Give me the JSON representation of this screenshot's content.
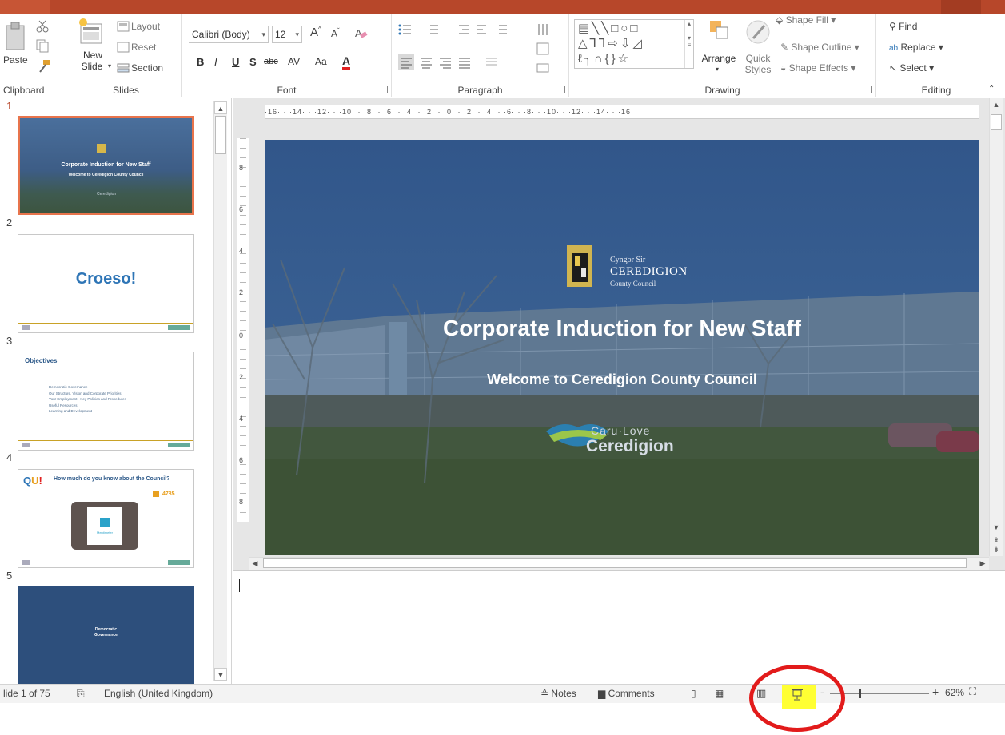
{
  "ribbon": {
    "clipboard": {
      "paste_label": "Paste",
      "group_label": "Clipboard"
    },
    "slides": {
      "new_slide_label": "New",
      "new_slide_label2": "Slide",
      "layout_label": "Layout",
      "reset_label": "Reset",
      "section_label": "Section",
      "group_label": "Slides"
    },
    "font": {
      "font_name": "Calibri (Body)",
      "font_size": "12",
      "group_label": "Font",
      "bold": "B",
      "italic": "I",
      "underline": "U",
      "shadow": "S",
      "strike": "abc",
      "spacing": "AV",
      "case": "Aa",
      "color": "A"
    },
    "paragraph": {
      "group_label": "Paragraph"
    },
    "drawing": {
      "arrange_label": "Arrange",
      "quick_styles_label": "Quick",
      "quick_styles_label2": "Styles",
      "shape_fill": "Shape Fill",
      "shape_outline": "Shape Outline",
      "shape_effects": "Shape Effects",
      "group_label": "Drawing"
    },
    "editing": {
      "find": "Find",
      "replace": "Replace",
      "select": "Select",
      "group_label": "Editing"
    }
  },
  "ruler": {
    "text": "·16· · ·14· · ·12· · ·10· · ·8· · ·6· · ·4· · ·2· · ·0· · ·2· · ·4· · ·6· · ·8· · ·10· · ·12· · ·14· · ·16·",
    "vnums": [
      "8",
      "6",
      "4",
      "2",
      "0",
      "2",
      "4",
      "6",
      "8"
    ]
  },
  "thumbnails": [
    {
      "num": "1",
      "title": "Corporate Induction for New Staff",
      "subtitle": "Welcome to Ceredigion County Council",
      "footer": "Ceredigion"
    },
    {
      "num": "2",
      "title": "Croeso!"
    },
    {
      "num": "3",
      "title": "Objectives",
      "bullets": [
        "Democratic Governance",
        "Our Structure, Vision and Corporate Priorities",
        "Your Employment - Key Policies and Procedures",
        "Useful Resources",
        "Learning and Development"
      ]
    },
    {
      "num": "4",
      "title": "How much do you know about the Council?",
      "code": "4785",
      "app": "Mentimeter"
    },
    {
      "num": "5",
      "title": "Democratic",
      "title2": "Governance"
    }
  ],
  "slide": {
    "logo_line1": "Cyngor Sir",
    "logo_line2": "CEREDIGION",
    "logo_line3": "County Council",
    "title": "Corporate Induction for New Staff",
    "subtitle": "Welcome to Ceredigion County Council",
    "brand_line1": "Caru·Love",
    "brand_line2": "Ceredigion"
  },
  "status": {
    "slide_info": "lide 1 of 75",
    "language": "English (United Kingdom)",
    "notes": "Notes",
    "comments": "Comments",
    "zoom": "62%",
    "zoom_level": 62
  },
  "colors": {
    "accent": "#b7472a",
    "selection": "#e8744c",
    "slide_overlay": "#2c4a78",
    "croeso_blue": "#2e75b6",
    "gold_line": "#c9a227",
    "highlight": "#ffff33",
    "annotation": "#e21b1b"
  }
}
